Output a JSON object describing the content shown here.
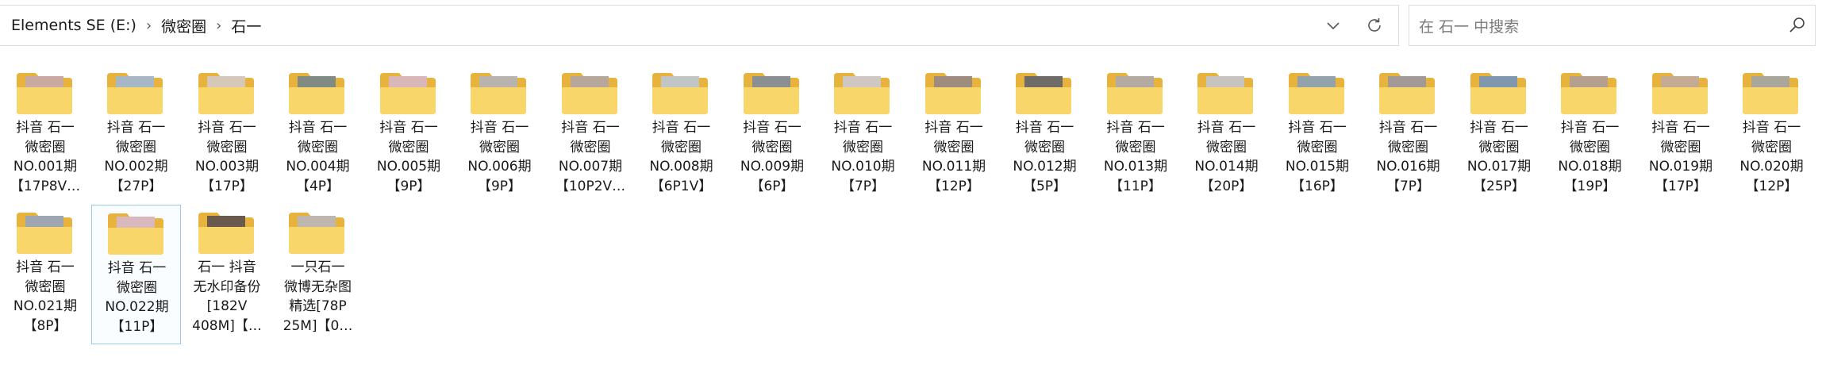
{
  "breadcrumb": [
    "Elements SE (E:)",
    "微密圈",
    "石一"
  ],
  "search": {
    "placeholder": "在 石一 中搜索"
  },
  "colors": {
    "folder_back": "#e8b33d",
    "folder_front": "#f9d66a",
    "selection_border": "#99c9ef"
  },
  "items": [
    {
      "label": "抖音 石一\n微密圈\nNO.001期\n【17P8V…",
      "thumb": "#c9a9a0"
    },
    {
      "label": "抖音 石一\n微密圈\nNO.002期\n【27P】",
      "thumb": "#a7b7c6"
    },
    {
      "label": "抖音 石一\n微密圈\nNO.003期\n【17P】",
      "thumb": "#d6c8b8"
    },
    {
      "label": "抖音 石一\n微密圈\nNO.004期\n【4P】",
      "thumb": "#7f8b83"
    },
    {
      "label": "抖音 石一\n微密圈\nNO.005期\n【9P】",
      "thumb": "#d9b6b8"
    },
    {
      "label": "抖音 石一\n微密圈\nNO.006期\n【9P】",
      "thumb": "#b9b3ad"
    },
    {
      "label": "抖音 石一\n微密圈\nNO.007期\n【10P2V…",
      "thumb": "#b7a79a"
    },
    {
      "label": "抖音 石一\n微密圈\nNO.008期\n【6P1V】",
      "thumb": "#c0c5c6"
    },
    {
      "label": "抖音 石一\n微密圈\nNO.009期\n【6P】",
      "thumb": "#8a9092"
    },
    {
      "label": "抖音 石一\n微密圈\nNO.010期\n【7P】",
      "thumb": "#cfc8c2"
    },
    {
      "label": "抖音 石一\n微密圈\nNO.011期\n【12P】",
      "thumb": "#9e8d7f"
    },
    {
      "label": "抖音 石一\n微密圈\nNO.012期\n【5P】",
      "thumb": "#6f6b66"
    },
    {
      "label": "抖音 石一\n微密圈\nNO.013期\n【11P】",
      "thumb": "#b3aaa1"
    },
    {
      "label": "抖音 石一\n微密圈\nNO.014期\n【20P】",
      "thumb": "#c7c3bf"
    },
    {
      "label": "抖音 石一\n微密圈\nNO.015期\n【16P】",
      "thumb": "#93a3ab"
    },
    {
      "label": "抖音 石一\n微密圈\nNO.016期\n【7P】",
      "thumb": "#a29a96"
    },
    {
      "label": "抖音 石一\n微密圈\nNO.017期\n【25P】",
      "thumb": "#7f98ae"
    },
    {
      "label": "抖音 石一\n微密圈\nNO.018期\n【19P】",
      "thumb": "#b59f8f"
    },
    {
      "label": "抖音 石一\n微密圈\nNO.019期\n【17P】",
      "thumb": "#c5ab94"
    },
    {
      "label": "抖音 石一\n微密圈\nNO.020期\n【12P】",
      "thumb": "#a9a79c"
    },
    {
      "label": "抖音 石一\n微密圈\nNO.021期\n【8P】",
      "thumb": "#9fa6b3"
    },
    {
      "label": "抖音 石一\n微密圈\nNO.022期\n【11P】",
      "thumb": "#d9b9bd",
      "selected": true
    },
    {
      "label": "石一 抖音\n无水印备份\n[182V\n408M]【…",
      "thumb": "#6a5a4e"
    },
    {
      "label": "一只石一\n微博无杂图\n精选[78P\n25M]【0…",
      "thumb": "#bdb7b0"
    }
  ]
}
